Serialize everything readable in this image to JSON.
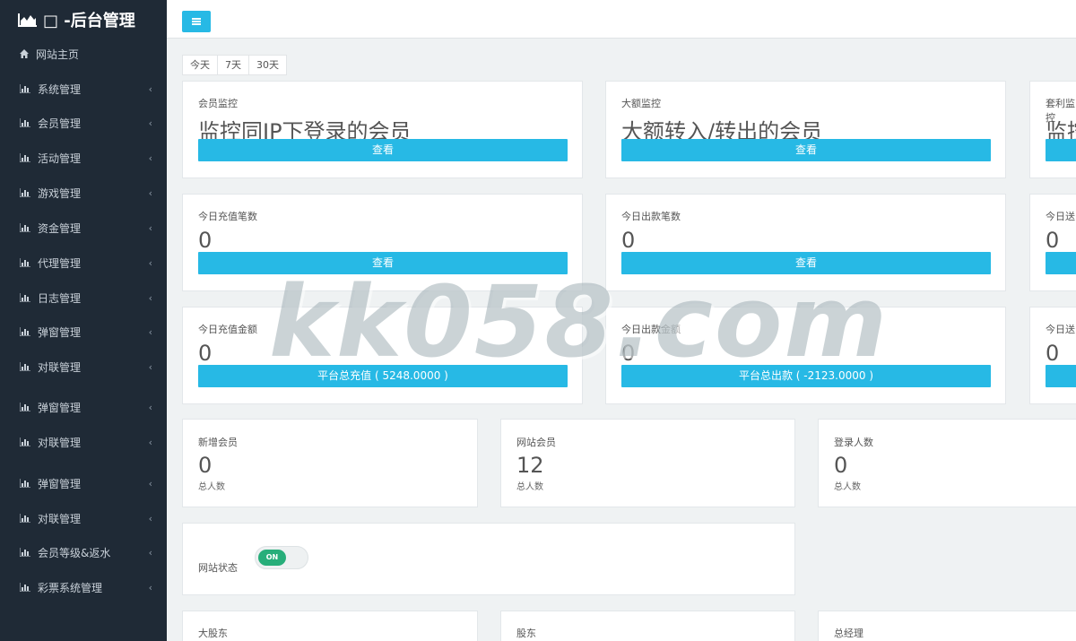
{
  "brand": {
    "title": "□ -后台管理",
    "icon": "area-chart-icon"
  },
  "sidebar": {
    "items": [
      {
        "label": "网站主页",
        "icon": "home-icon"
      },
      {
        "label": "系统管理",
        "icon": "bar-chart-icon"
      },
      {
        "label": "会员管理",
        "icon": "bar-chart-icon"
      },
      {
        "label": "活动管理",
        "icon": "bar-chart-icon"
      },
      {
        "label": "游戏管理",
        "icon": "bar-chart-icon"
      },
      {
        "label": "资金管理",
        "icon": "bar-chart-icon"
      },
      {
        "label": "代理管理",
        "icon": "bar-chart-icon"
      },
      {
        "label": "日志管理",
        "icon": "bar-chart-icon"
      },
      {
        "label": "弹窗管理",
        "icon": "bar-chart-icon"
      },
      {
        "label": "对联管理",
        "icon": "bar-chart-icon"
      },
      {
        "label": "弹窗管理",
        "icon": "bar-chart-icon"
      },
      {
        "label": "对联管理",
        "icon": "bar-chart-icon"
      },
      {
        "label": "弹窗管理",
        "icon": "bar-chart-icon"
      },
      {
        "label": "对联管理",
        "icon": "bar-chart-icon"
      },
      {
        "label": "会员等级&返水",
        "icon": "bar-chart-icon"
      },
      {
        "label": "彩票系统管理",
        "icon": "bar-chart-icon"
      }
    ],
    "chevron": "‹"
  },
  "range": {
    "today": "今天",
    "d7": "7天",
    "d30": "30天"
  },
  "monitor": {
    "member": {
      "label": "会员监控",
      "text": "监控同IP下登录的会员",
      "btn": "查看"
    },
    "large": {
      "label": "大额监控",
      "text": "大额转入/转出的会员",
      "btn": "查看"
    },
    "arb": {
      "label": "套利监控",
      "text": "监控",
      "btn": ""
    }
  },
  "counts": {
    "deposit": {
      "label": "今日充值笔数",
      "value": "0",
      "btn": "查看"
    },
    "withdraw": {
      "label": "今日出款笔数",
      "value": "0",
      "btn": "查看"
    },
    "gift": {
      "label": "今日送",
      "value": "0",
      "btn": ""
    }
  },
  "amounts": {
    "deposit": {
      "label": "今日充值金额",
      "value": "0",
      "btn": "平台总充值 ( 5248.0000 )"
    },
    "withdraw": {
      "label": "今日出款金额",
      "value": "0",
      "btn": "平台总出款 ( -2123.0000 )"
    },
    "gift": {
      "label": "今日送",
      "value": "0",
      "btn": ""
    }
  },
  "stats": {
    "new_members": {
      "label": "新增会员",
      "value": "0",
      "sub": "总人数"
    },
    "site_members": {
      "label": "网站会员",
      "value": "12",
      "sub": "总人数"
    },
    "logins": {
      "label": "登录人数",
      "value": "0",
      "sub": "总人数"
    }
  },
  "site_status": {
    "label": "网站状态",
    "toggle": "ON"
  },
  "agents": {
    "major": {
      "label": "大股东"
    },
    "share": {
      "label": "股东"
    },
    "gm": {
      "label": "总经理"
    }
  },
  "watermark": "kk058.com",
  "colors": {
    "sidebar": "#1f2a36",
    "accent": "#27b9e5",
    "toggle_on": "#27ae7a"
  }
}
